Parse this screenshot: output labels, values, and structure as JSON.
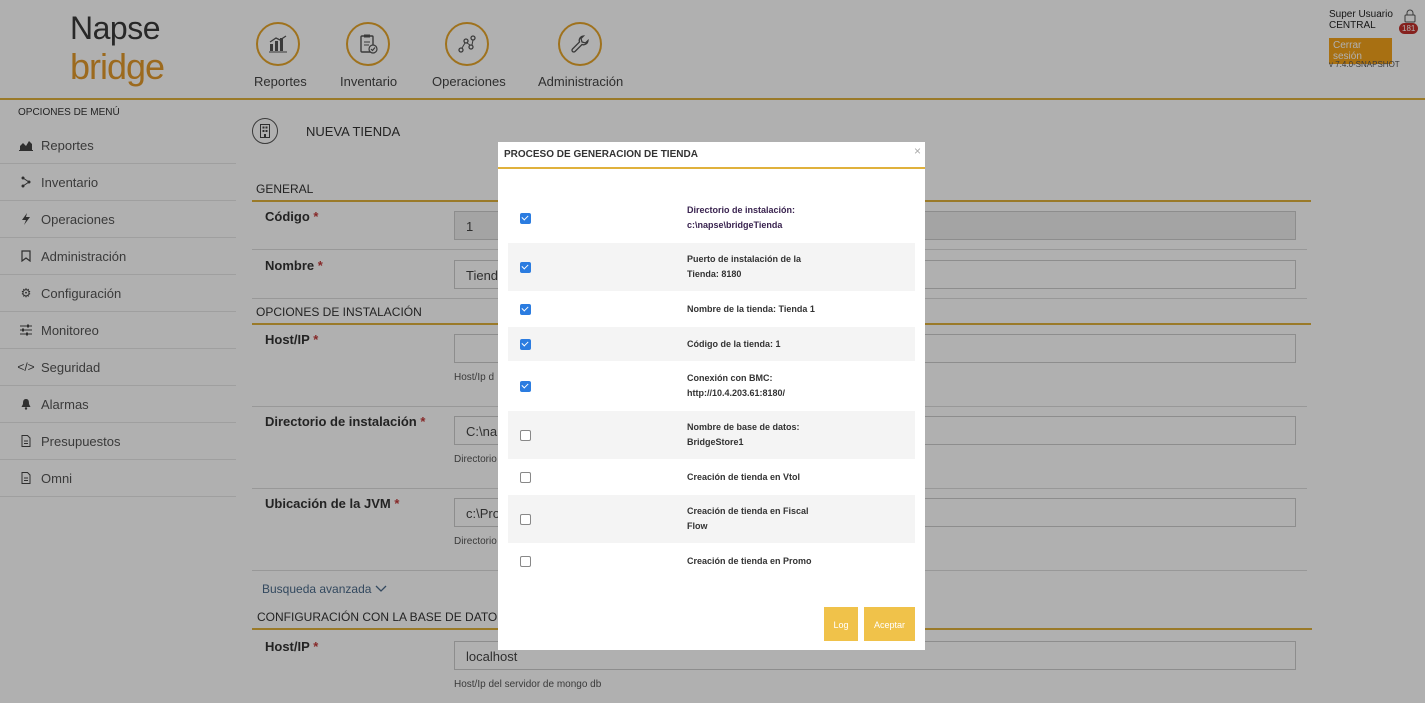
{
  "logo": {
    "line1": "Napse",
    "line2": "bridge"
  },
  "modules": [
    {
      "label": "Reportes",
      "icon": "chart-icon"
    },
    {
      "label": "Inventario",
      "icon": "clipboard-icon"
    },
    {
      "label": "Operaciones",
      "icon": "operations-icon"
    },
    {
      "label": "Administración",
      "icon": "wrench-icon"
    }
  ],
  "user": {
    "name_line1": "Super Usuario",
    "name_line2": "CENTRAL",
    "badge_count": "181",
    "logout_label": "Cerrar sesión",
    "version": "v 7.4.0-SNAPSHOT"
  },
  "sidebar": {
    "title": "OPCIONES DE MENÚ",
    "items": [
      {
        "label": "Reportes",
        "icon": "area-chart-icon"
      },
      {
        "label": "Inventario",
        "icon": "tree-icon"
      },
      {
        "label": "Operaciones",
        "icon": "bolt-icon"
      },
      {
        "label": "Administración",
        "icon": "bookmark-icon"
      },
      {
        "label": "Configuración",
        "icon": "gear-icon"
      },
      {
        "label": "Monitoreo",
        "icon": "sliders-icon"
      },
      {
        "label": "Seguridad",
        "icon": "code-icon"
      },
      {
        "label": "Alarmas",
        "icon": "bell-icon"
      },
      {
        "label": "Presupuestos",
        "icon": "document-icon"
      },
      {
        "label": "Omni",
        "icon": "document-icon"
      }
    ]
  },
  "page": {
    "title": "NUEVA TIENDA",
    "sections": {
      "general": "GENERAL",
      "install": "OPCIONES DE INSTALACIÓN",
      "db": "CONFIGURACIÓN CON LA BASE DE DATOS"
    },
    "fields": {
      "codigo": {
        "label": "Código",
        "value": "1"
      },
      "nombre": {
        "label": "Nombre",
        "value": "Tienda"
      },
      "host": {
        "label": "Host/IP",
        "value": "",
        "hint": "Host/Ip d"
      },
      "dir": {
        "label": "Directorio de instalación",
        "value": "C:\\nap",
        "hint": "Directorio"
      },
      "jvm": {
        "label": "Ubicación de la JVM",
        "value": "c:\\Pro",
        "hint": "Directorio"
      },
      "dbhost": {
        "label": "Host/IP",
        "value": "localhost",
        "hint": "Host/Ip del servidor de mongo db"
      }
    },
    "required_mark": "*",
    "advanced_search": "Busqueda avanzada"
  },
  "modal": {
    "title": "PROCESO DE GENERACION DE TIENDA",
    "close": "×",
    "steps": [
      {
        "line1": "Directorio de instalación:",
        "line2": "c:\\napse\\bridgeTienda",
        "checked": true
      },
      {
        "line1": "Puerto de instalación de la",
        "line2": "Tienda: 8180",
        "checked": true
      },
      {
        "line1": "Nombre de la tienda: Tienda 1",
        "line2": "",
        "checked": true
      },
      {
        "line1": "Código de la tienda: 1",
        "line2": "",
        "checked": true
      },
      {
        "line1": "Conexión con BMC:",
        "line2": "http://10.4.203.61:8180/",
        "checked": true
      },
      {
        "line1": "Nombre de base de datos:",
        "line2": "BridgeStore1",
        "checked": false
      },
      {
        "line1": "Creación de tienda en Vtol",
        "line2": "",
        "checked": false
      },
      {
        "line1": "Creación de tienda en Fiscal",
        "line2": "Flow",
        "checked": false
      },
      {
        "line1": "Creación de tienda en Promo",
        "line2": "",
        "checked": false
      }
    ],
    "log_label": "Log",
    "accept_label": "Aceptar"
  }
}
